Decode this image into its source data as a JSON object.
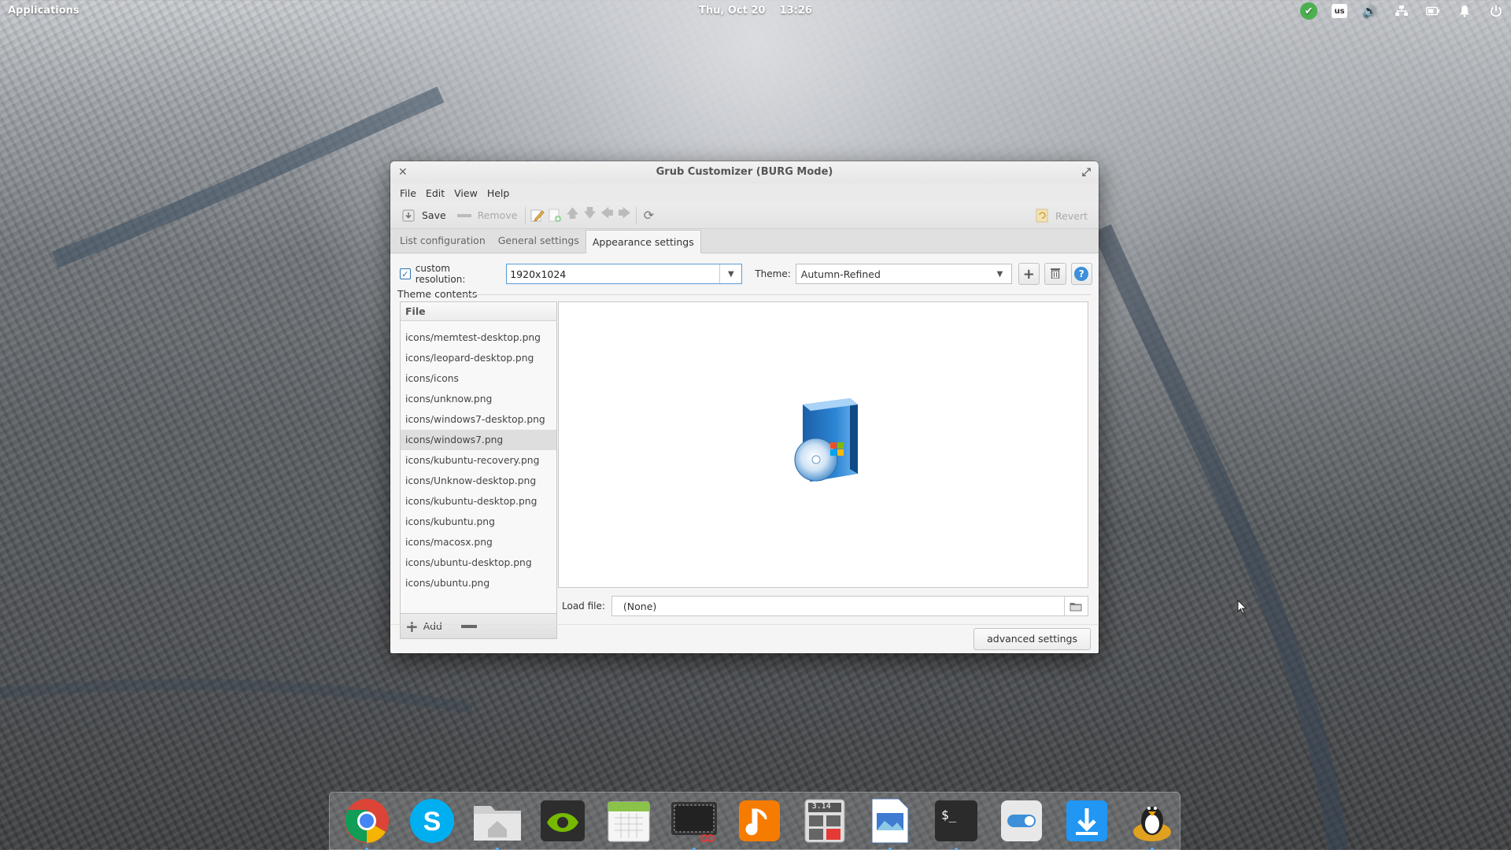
{
  "top_panel": {
    "applications": "Applications",
    "date": "Thu, Oct 20",
    "time": "13:26",
    "keyboard_layout": "us",
    "indicators": [
      "update-icon",
      "keyboard-layout-icon",
      "volume-icon",
      "network-icon",
      "battery-icon",
      "notifications-icon",
      "power-icon"
    ]
  },
  "window": {
    "title": "Grub Customizer (BURG Mode)",
    "menus": [
      "File",
      "Edit",
      "View",
      "Help"
    ],
    "toolbar": {
      "save": "Save",
      "remove": "Remove",
      "revert": "Revert",
      "icons": [
        "save-icon",
        "remove-icon",
        "edit-icon",
        "add-entry-icon",
        "move-up-icon",
        "move-down-icon",
        "move-left-icon",
        "move-right-icon",
        "reload-icon",
        "revert-icon"
      ]
    },
    "tabs": [
      "List configuration",
      "General settings",
      "Appearance settings"
    ],
    "active_tab": "Appearance settings",
    "appearance": {
      "custom_resolution_label": "custom resolution:",
      "custom_resolution_checked": true,
      "resolution_value": "1920x1024",
      "theme_label": "Theme:",
      "theme_value": "Autumn-Refined",
      "theme_contents_label": "Theme contents",
      "file_header": "File",
      "files": [
        "icons/memtest-desktop.png",
        "icons/leopard-desktop.png",
        "icons/icons",
        "icons/unknow.png",
        "icons/windows7-desktop.png",
        "icons/windows7.png",
        "icons/kubuntu-recovery.png",
        "icons/Unknow-desktop.png",
        "icons/kubuntu-desktop.png",
        "icons/kubuntu.png",
        "icons/macosx.png",
        "icons/ubuntu-desktop.png",
        "icons/ubuntu.png"
      ],
      "selected_file": "icons/windows7.png",
      "add_label": "Add",
      "load_file_label": "Load file:",
      "load_file_value": "(None)",
      "advanced_settings": "advanced settings"
    }
  },
  "dock": {
    "apps": [
      "chrome-icon",
      "skype-icon",
      "home-folder-icon",
      "nvidia-icon",
      "calendar-icon",
      "screenshot-icon",
      "music-icon",
      "calculator-icon",
      "document-viewer-icon",
      "terminal-icon",
      "settings-toggle-icon",
      "download-icon",
      "tux-icon"
    ],
    "calculator_display": "3.14"
  },
  "colors": {
    "accent": "#2a74b8",
    "selection": "#dedede"
  }
}
